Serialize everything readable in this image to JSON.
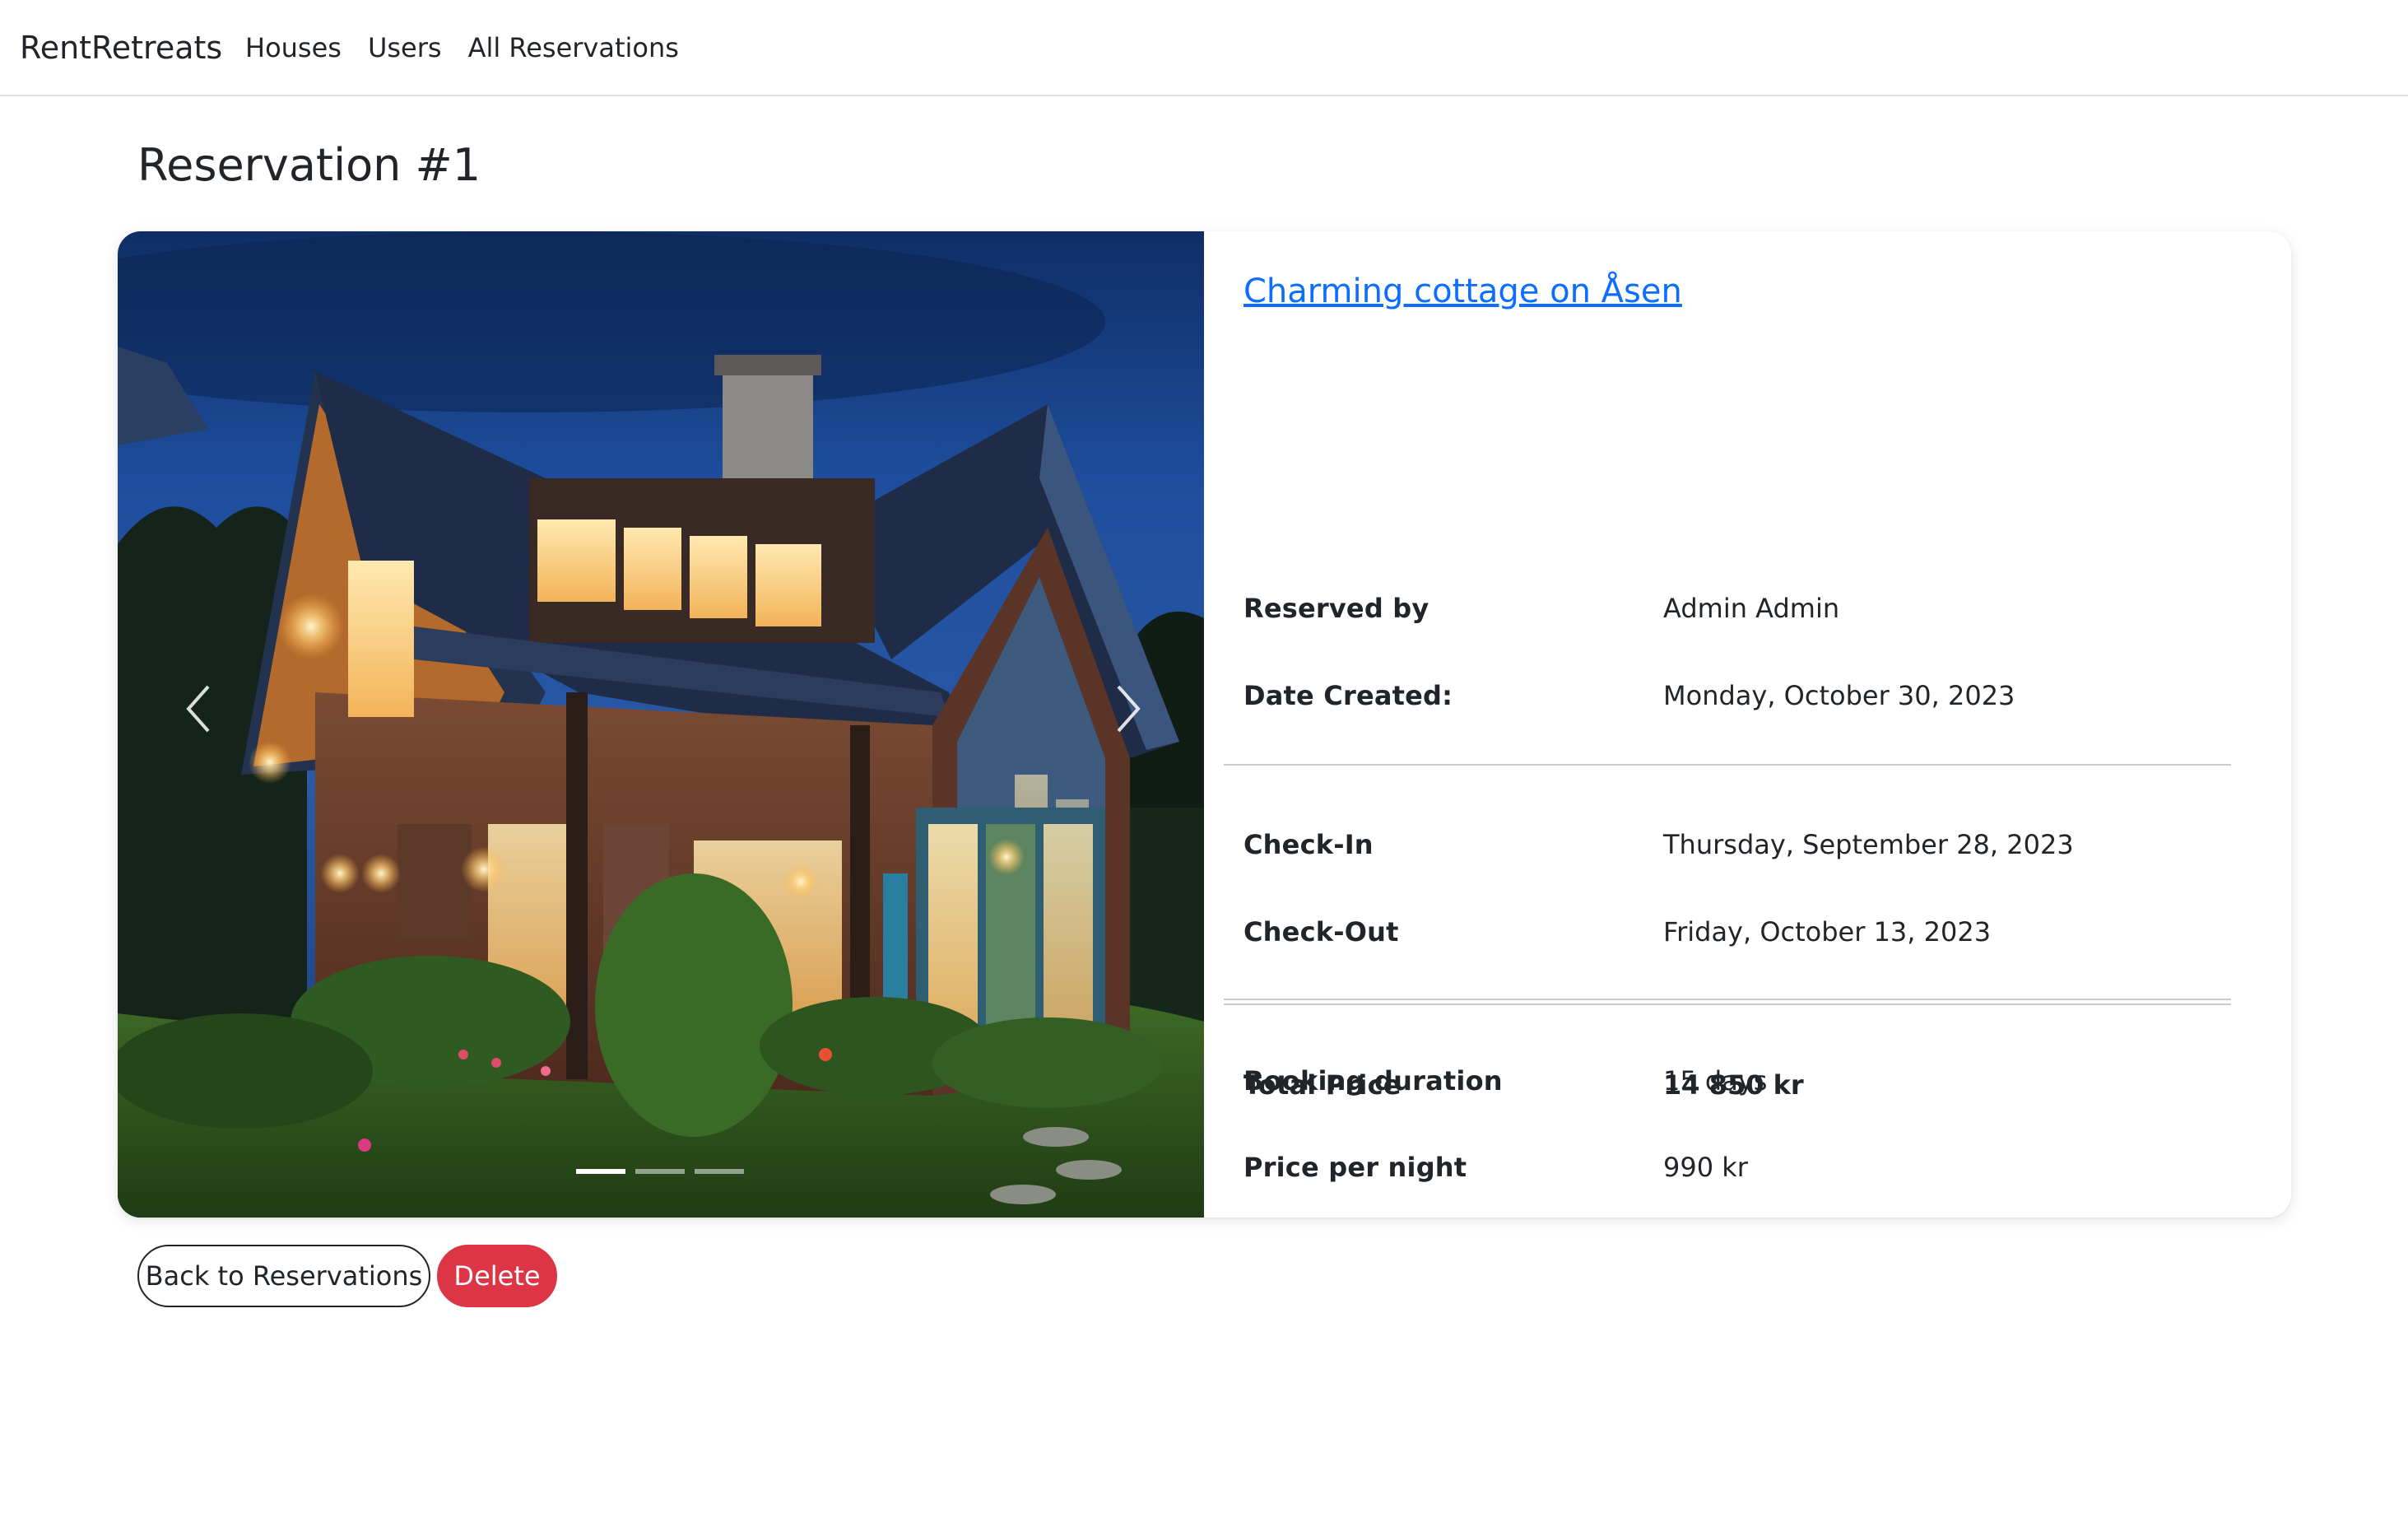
{
  "navbar": {
    "brand": "RentRetreats",
    "links": [
      {
        "label": "Houses"
      },
      {
        "label": "Users"
      },
      {
        "label": "All Reservations"
      }
    ]
  },
  "page": {
    "title": "Reservation #1"
  },
  "carousel": {
    "slide_count": 3,
    "active_index": 0,
    "prev_icon": "chevron-left-icon",
    "next_icon": "chevron-right-icon"
  },
  "details": {
    "house_name": "Charming cottage on Åsen",
    "rows": [
      {
        "label": "Reserved by",
        "value": "Admin Admin"
      },
      {
        "label": "Date Created:",
        "value": "Monday, October 30, 2023"
      },
      {
        "label": "Check-In",
        "value": "Thursday, September 28, 2023"
      },
      {
        "label": "Check-Out",
        "value": "Friday, October 13, 2023"
      },
      {
        "label": "Booking duration",
        "value": "15 days"
      },
      {
        "label": "Price per night",
        "value": "990 kr"
      },
      {
        "label": "Total Price",
        "value": "14 850 kr"
      }
    ]
  },
  "actions": {
    "back_label": "Back to Reservations",
    "delete_label": "Delete"
  },
  "colors": {
    "link": "#0d6efd",
    "danger": "#dc3545",
    "text": "#212529",
    "divider": "#dee2e6"
  }
}
